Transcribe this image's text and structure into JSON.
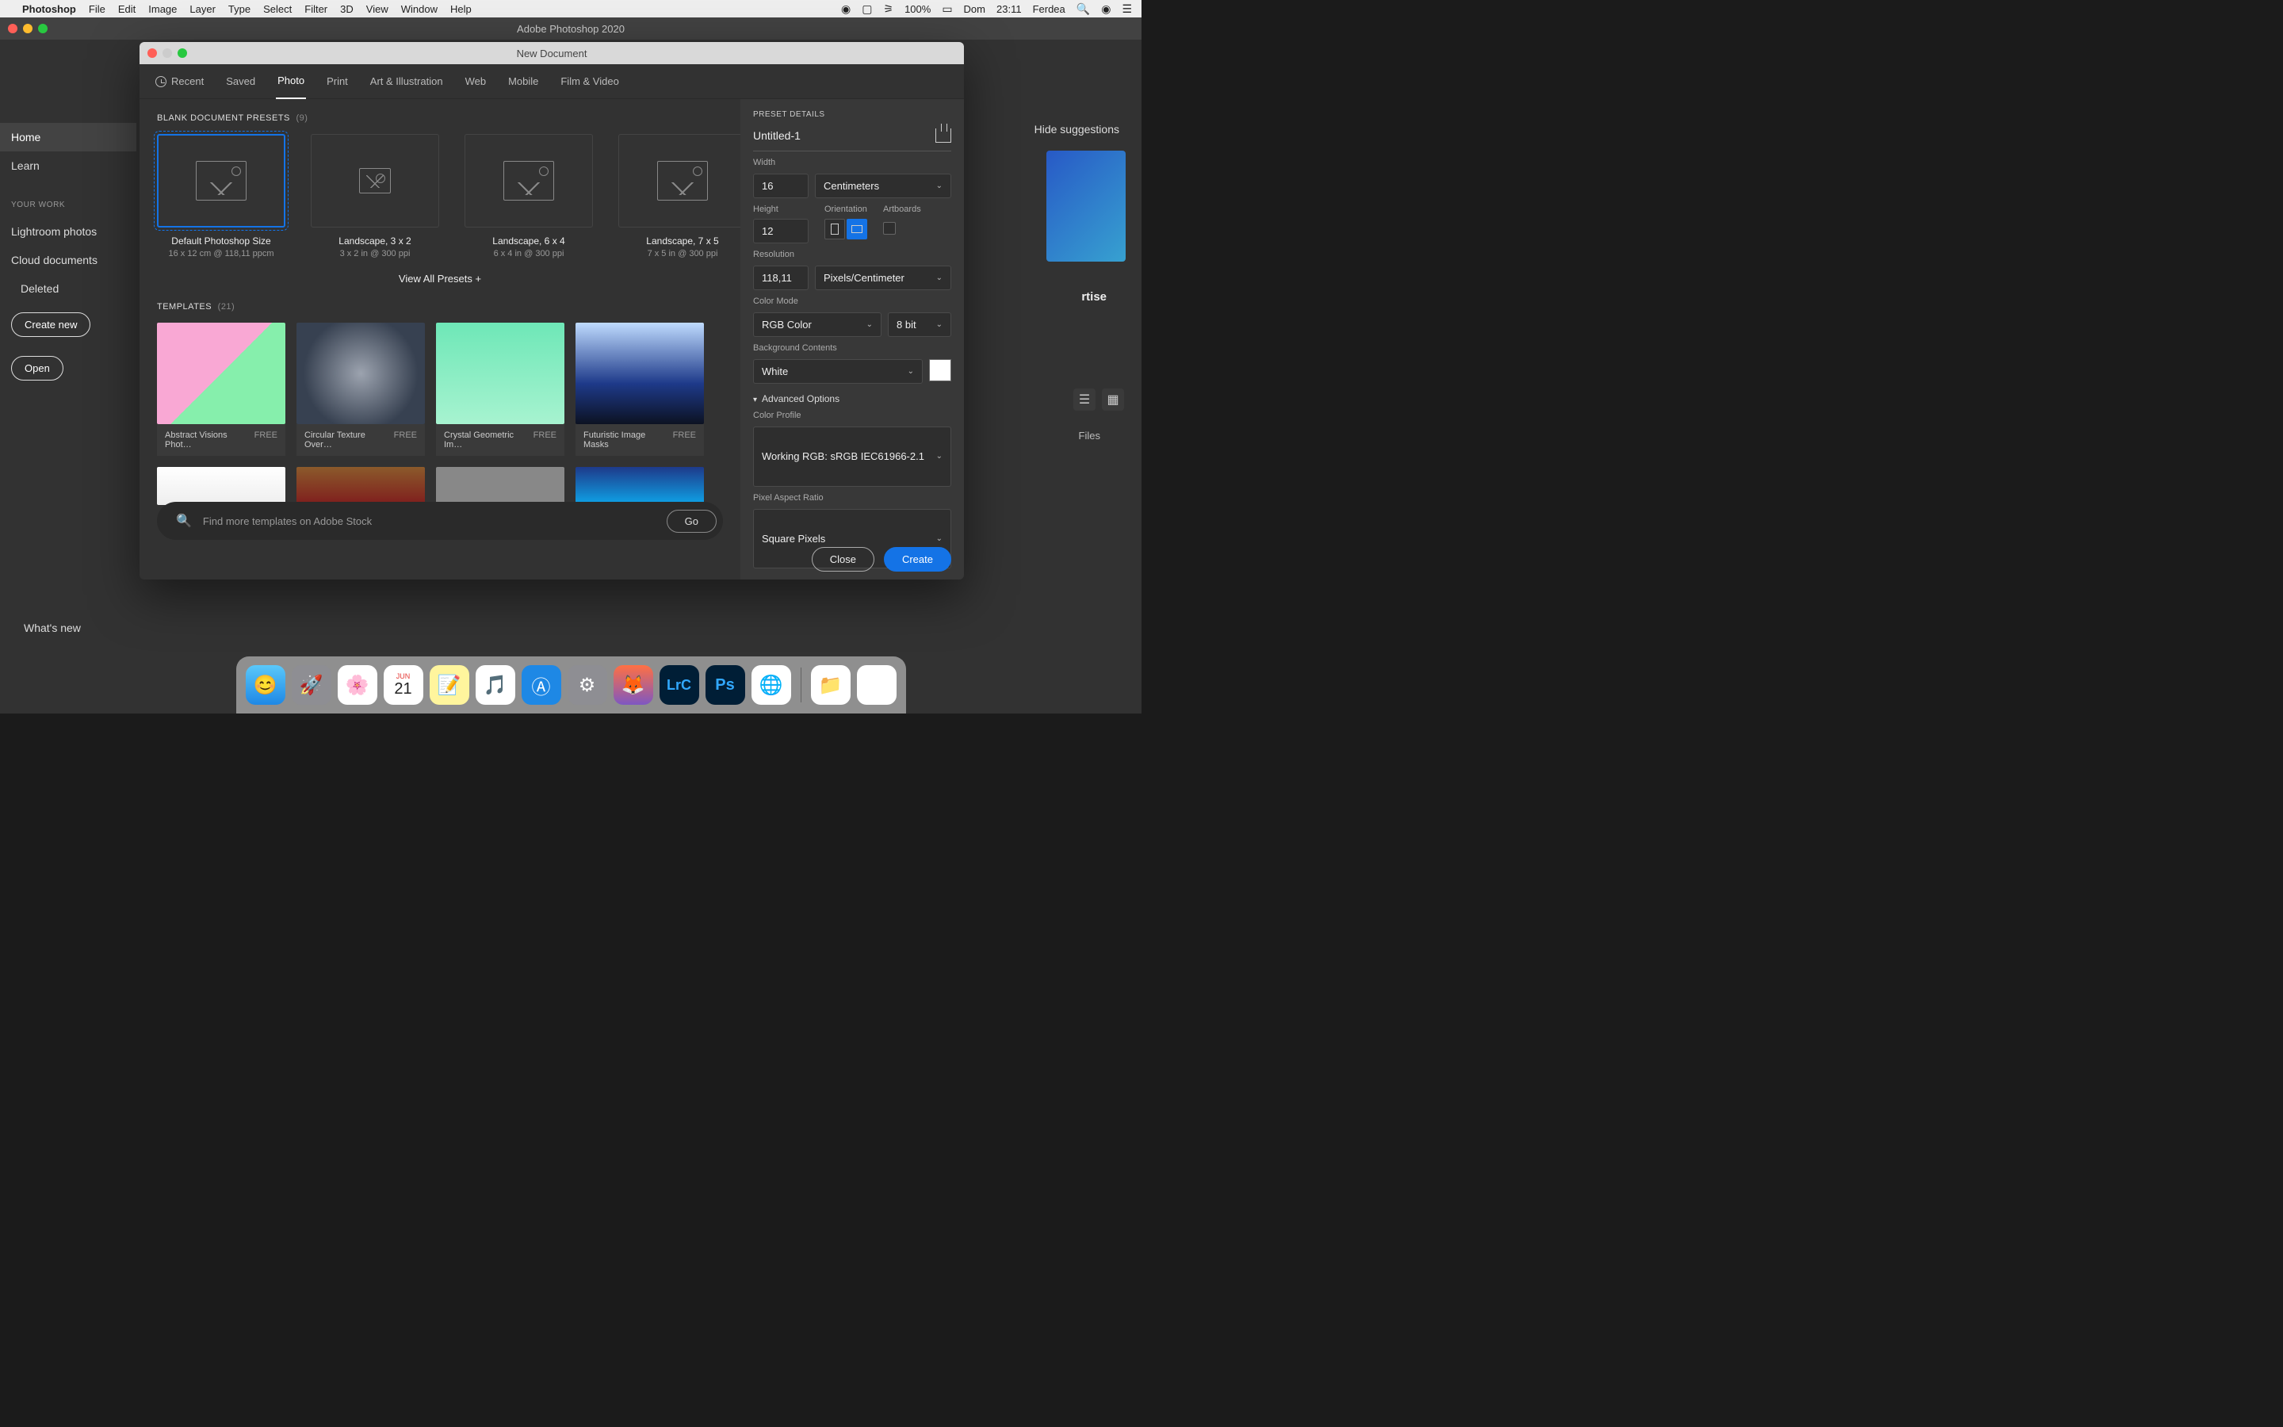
{
  "menubar": {
    "app": "Photoshop",
    "items": [
      "File",
      "Edit",
      "Image",
      "Layer",
      "Type",
      "Select",
      "Filter",
      "3D",
      "View",
      "Window",
      "Help"
    ],
    "right": {
      "battery": "100%",
      "day": "Dom",
      "time": "23:11",
      "user": "Ferdea"
    }
  },
  "app_title": "Adobe Photoshop 2020",
  "home": {
    "nav": {
      "home": "Home",
      "learn": "Learn",
      "your_work": "YOUR WORK",
      "lightroom": "Lightroom photos",
      "cloud": "Cloud documents",
      "deleted": "Deleted"
    },
    "create_new": "Create new",
    "open": "Open",
    "whats_new": "What's new",
    "hide_suggestions": "Hide suggestions",
    "right_text": "rtise",
    "files": "Files"
  },
  "dialog": {
    "title": "New Document",
    "tabs": {
      "recent": "Recent",
      "saved": "Saved",
      "photo": "Photo",
      "print": "Print",
      "art": "Art & Illustration",
      "web": "Web",
      "mobile": "Mobile",
      "film": "Film & Video"
    },
    "presets_header": "BLANK DOCUMENT PRESETS",
    "presets_count": "(9)",
    "presets": [
      {
        "name": "Default Photoshop Size",
        "meta": "16 x 12 cm @ 118,11 ppcm"
      },
      {
        "name": "Landscape, 3 x 2",
        "meta": "3 x 2 in @ 300 ppi"
      },
      {
        "name": "Landscape, 6 x 4",
        "meta": "6 x 4 in @ 300 ppi"
      },
      {
        "name": "Landscape, 7 x 5",
        "meta": "7 x 5 in @ 300 ppi"
      }
    ],
    "view_all": "View All Presets +",
    "templates_header": "TEMPLATES",
    "templates_count": "(21)",
    "templates": [
      {
        "name": "Abstract Visions Phot…",
        "price": "FREE"
      },
      {
        "name": "Circular Texture Over…",
        "price": "FREE"
      },
      {
        "name": "Crystal Geometric Im…",
        "price": "FREE"
      },
      {
        "name": "Futuristic Image Masks",
        "price": "FREE"
      }
    ],
    "search_placeholder": "Find more templates on Adobe Stock",
    "go": "Go",
    "close": "Close",
    "create": "Create"
  },
  "details": {
    "header": "PRESET DETAILS",
    "docname": "Untitled-1",
    "width_label": "Width",
    "width": "16",
    "units": "Centimeters",
    "height_label": "Height",
    "height": "12",
    "orientation_label": "Orientation",
    "artboards_label": "Artboards",
    "resolution_label": "Resolution",
    "resolution": "118,11",
    "resolution_units": "Pixels/Centimeter",
    "color_mode_label": "Color Mode",
    "color_mode": "RGB Color",
    "bit_depth": "8 bit",
    "bg_label": "Background Contents",
    "bg": "White",
    "advanced": "Advanced Options",
    "profile_label": "Color Profile",
    "profile": "Working RGB: sRGB IEC61966-2.1",
    "aspect_label": "Pixel Aspect Ratio",
    "aspect": "Square Pixels"
  },
  "dock": [
    "finder",
    "launchpad",
    "photos",
    "calendar",
    "notes",
    "music",
    "appstore",
    "settings",
    "firefox",
    "lrc",
    "ps",
    "chrome"
  ]
}
